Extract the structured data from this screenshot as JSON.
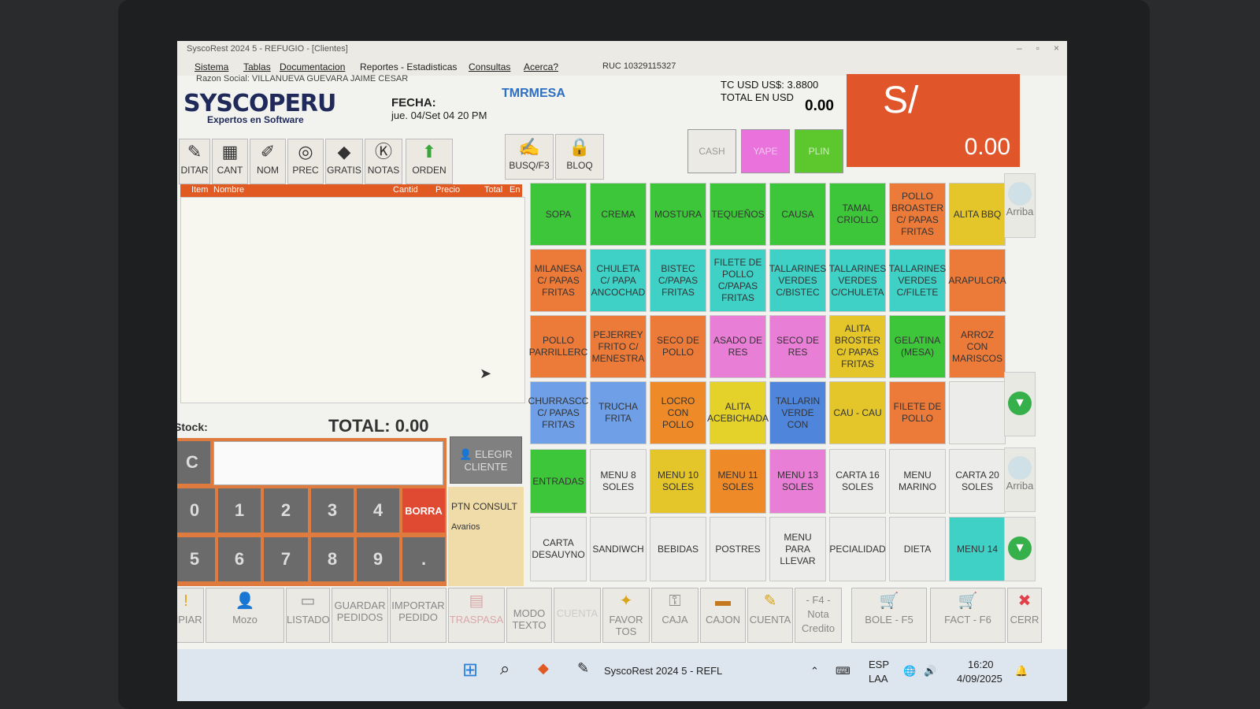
{
  "window": {
    "title": "SyscoRest 2024 5 - REFUGIO - [Clientes]"
  },
  "menu": [
    "Sistema",
    "Tablas",
    "Documentacion",
    "Reportes - Estadisticas",
    "Consultas",
    "Acerca?"
  ],
  "ruc": "RUC 10329115327",
  "razon_social": "Razon Social: VILLANUEVA GUEVARA JAIME CESAR",
  "brand": {
    "logo": "SYSCOPERU",
    "tagline": "Expertos en Software"
  },
  "fecha": {
    "label": "FECHA:",
    "value": "jue. 04/Set 04 20 PM"
  },
  "mesa": "TMRMESA",
  "tc": {
    "line1": "TC USD  US$: 3.8800",
    "line2": "TOTAL EN USD",
    "usd_total": "0.00"
  },
  "sol": {
    "currency": "S/",
    "amount": "0.00"
  },
  "pay_buttons": [
    "CASH",
    "YAPE",
    "PLIN"
  ],
  "toolbar": [
    "DITAR",
    "CANT",
    "NOM",
    "PREC",
    "GRATIS",
    "NOTAS",
    "ORDEN",
    "BUSQ/F3",
    "BLOQ"
  ],
  "list_headers": [
    "Item",
    "Nombre",
    "Cantid",
    "Precio",
    "Total",
    "En"
  ],
  "stock_label": "Stock:",
  "total_label": "TOTAL: 0.00",
  "keypad": {
    "clear": "C",
    "digits": [
      "0",
      "1",
      "2",
      "3",
      "4",
      "5",
      "6",
      "7",
      "8",
      "9",
      "."
    ],
    "borra": "BORRA"
  },
  "cliente_btn": "ELEGIR CLIENTE",
  "ptn_consult": "PTN CONSULT",
  "avarios": "Avarios",
  "products": [
    {
      "label": "SOPA",
      "color": "#3ec63a"
    },
    {
      "label": "CREMA",
      "color": "#3ec63a"
    },
    {
      "label": "MOSTURA",
      "color": "#3ec63a"
    },
    {
      "label": "TEQUEÑOS",
      "color": "#3ec63a"
    },
    {
      "label": "CAUSA",
      "color": "#3ec63a"
    },
    {
      "label": "TAMAL CRIOLLO",
      "color": "#3ec63a"
    },
    {
      "label": "POLLO BROASTER C/ PAPAS FRITAS",
      "color": "#ec7b3a"
    },
    {
      "label": "ALITA BBQ",
      "color": "#e4c62a"
    },
    {
      "label": "MILANESA C/ PAPAS FRITAS",
      "color": "#ec7b3a"
    },
    {
      "label": "CHULETA C/ PAPA ANCOCHAD",
      "color": "#3fd1c6"
    },
    {
      "label": "BISTEC C/PAPAS FRITAS",
      "color": "#3fd1c6"
    },
    {
      "label": "FILETE DE POLLO C/PAPAS FRITAS",
      "color": "#3fd1c6"
    },
    {
      "label": "TALLARINES VERDES C/BISTEC",
      "color": "#3fd1c6"
    },
    {
      "label": "TALLARINES VERDES C/CHULETA",
      "color": "#3fd1c6"
    },
    {
      "label": "TALLARINES VERDES C/FILETE",
      "color": "#3fd1c6"
    },
    {
      "label": "ARAPULCRA",
      "color": "#ec7b3a"
    },
    {
      "label": "POLLO PARRILLERC",
      "color": "#ec7b3a"
    },
    {
      "label": "PEJERREY FRITO C/ MENESTRA",
      "color": "#ec7b3a"
    },
    {
      "label": "SECO DE POLLO",
      "color": "#ec7b3a"
    },
    {
      "label": "ASADO DE RES",
      "color": "#e97ed6"
    },
    {
      "label": "SECO DE RES",
      "color": "#e97ed6"
    },
    {
      "label": "ALITA BROSTER C/ PAPAS FRITAS",
      "color": "#e4c62a"
    },
    {
      "label": "GELATINA (MESA)",
      "color": "#3ec63a"
    },
    {
      "label": "ARROZ CON MARISCOS",
      "color": "#ec7b3a"
    },
    {
      "label": "CHURRASCC C/ PAPAS FRITAS",
      "color": "#6f9fe6"
    },
    {
      "label": "TRUCHA FRITA",
      "color": "#6f9fe6"
    },
    {
      "label": "LOCRO CON POLLO",
      "color": "#ef8a28"
    },
    {
      "label": "ALITA ACEBICHADA",
      "color": "#e4d22a"
    },
    {
      "label": "TALLARIN VERDE CON",
      "color": "#4f86dc"
    },
    {
      "label": "CAU - CAU",
      "color": "#e4c62a"
    },
    {
      "label": "FILETE DE POLLO",
      "color": "#ec7b3a"
    },
    {
      "label": "",
      "color": "#ececea"
    }
  ],
  "categories": [
    {
      "label": "ENTRADAS",
      "color": "#3ec63a"
    },
    {
      "label": "MENU 8 SOLES",
      "color": "#ececea"
    },
    {
      "label": "MENU 10 SOLES",
      "color": "#e4c62a"
    },
    {
      "label": "MENU 11 SOLES",
      "color": "#ef8a28"
    },
    {
      "label": "MENU 13 SOLES",
      "color": "#e97ed6"
    },
    {
      "label": "CARTA 16 SOLES",
      "color": "#ececea"
    },
    {
      "label": "MENU MARINO",
      "color": "#ececea"
    },
    {
      "label": "CARTA 20 SOLES",
      "color": "#ececea"
    },
    {
      "label": "CARTA DESAUYNO",
      "color": "#ececea"
    },
    {
      "label": "SANDIWCH",
      "color": "#ececea"
    },
    {
      "label": "BEBIDAS",
      "color": "#ececea"
    },
    {
      "label": "POSTRES",
      "color": "#ececea"
    },
    {
      "label": "MENU PARA LLEVAR",
      "color": "#ececea"
    },
    {
      "label": "PECIALIDAD",
      "color": "#ececea"
    },
    {
      "label": "DIETA",
      "color": "#ececea"
    },
    {
      "label": "MENU 14",
      "color": "#3fd1c6"
    }
  ],
  "side": {
    "arriba": "Arriba"
  },
  "bottom_buttons": [
    "MPIAR",
    "Mozo",
    "LISTADO",
    "GUARDAR PEDIDOS",
    "IMPORTAR PEDIDO",
    "TRASPASA",
    "MODO TEXTO",
    "CUENTA",
    "FAVOR TOS",
    "CAJA",
    "CAJON",
    "CUENTA",
    "- F4 - Nota Credito",
    "BOLE - F5",
    "FACT - F6",
    "CERR"
  ],
  "taskbar": {
    "app": "SyscoRest 2024 5 - REFL",
    "lang1": "ESP",
    "lang2": "LAA",
    "time": "16:20",
    "date": "4/09/2025"
  }
}
